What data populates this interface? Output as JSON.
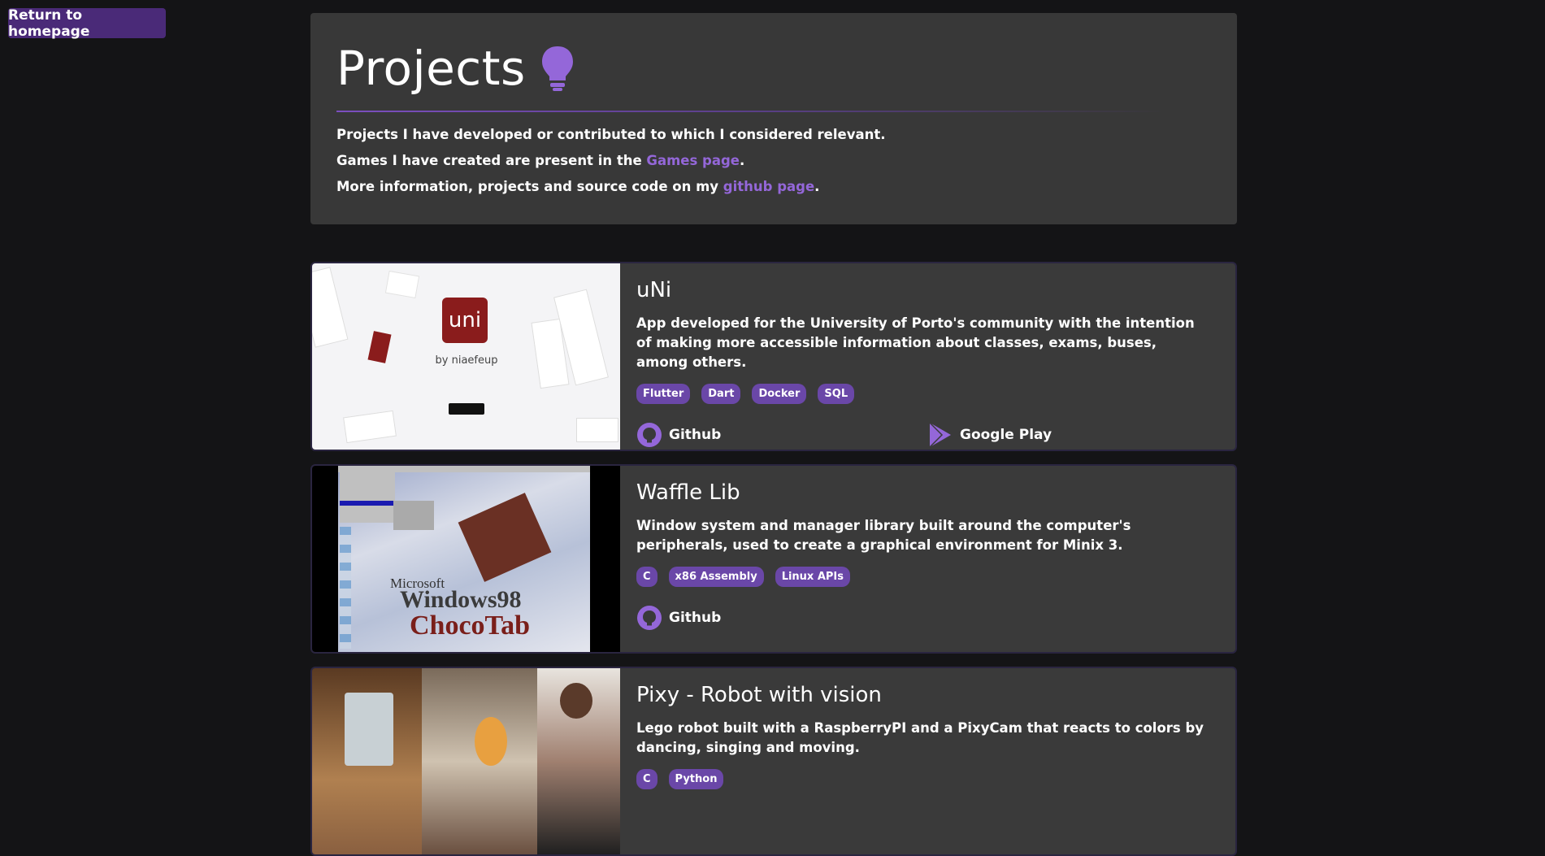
{
  "nav": {
    "home_label": "Return to homepage"
  },
  "intro": {
    "title": "Projects",
    "line1": "Projects I have developed or contributed to which I considered relevant.",
    "line2_prefix": "Games I have created are present in the ",
    "line2_link": "Games page",
    "line2_suffix": ".",
    "line3_prefix": "More information, projects and source code on my ",
    "line3_link": "github page",
    "line3_suffix": "."
  },
  "colors": {
    "accent": "#9467d9",
    "tag_bg": "#6a47a8",
    "card_bg": "#3a3a3a",
    "page_bg": "#141416"
  },
  "projects": [
    {
      "title": "uNi",
      "description": "App developed for the University of Porto's community with the intention of making more accessible information about classes, exams, buses, among others.",
      "tags": [
        "Flutter",
        "Dart",
        "Docker",
        "SQL"
      ],
      "links": [
        {
          "label": "Github",
          "icon": "github-icon"
        },
        {
          "label": "Google Play",
          "icon": "google-play-icon"
        }
      ],
      "thumb": {
        "logo_text": "uni",
        "byline": "by niaefeup"
      }
    },
    {
      "title": "Waffle Lib",
      "description": "Window system and manager library built around the computer's peripherals, used to create a graphical environment for Minix 3.",
      "tags": [
        "C",
        "x86 Assembly",
        "Linux APIs"
      ],
      "links": [
        {
          "label": "Github",
          "icon": "github-icon"
        }
      ],
      "thumb": {
        "line1": "Microsoft",
        "line2": "Windows98",
        "line3": "ChocoTab"
      }
    },
    {
      "title": "Pixy - Robot with vision",
      "description": "Lego robot built with a RaspberryPI and a PixyCam that reacts to colors by dancing, singing and moving.",
      "tags": [
        "C",
        "Python"
      ],
      "links": [],
      "thumb": {}
    }
  ]
}
